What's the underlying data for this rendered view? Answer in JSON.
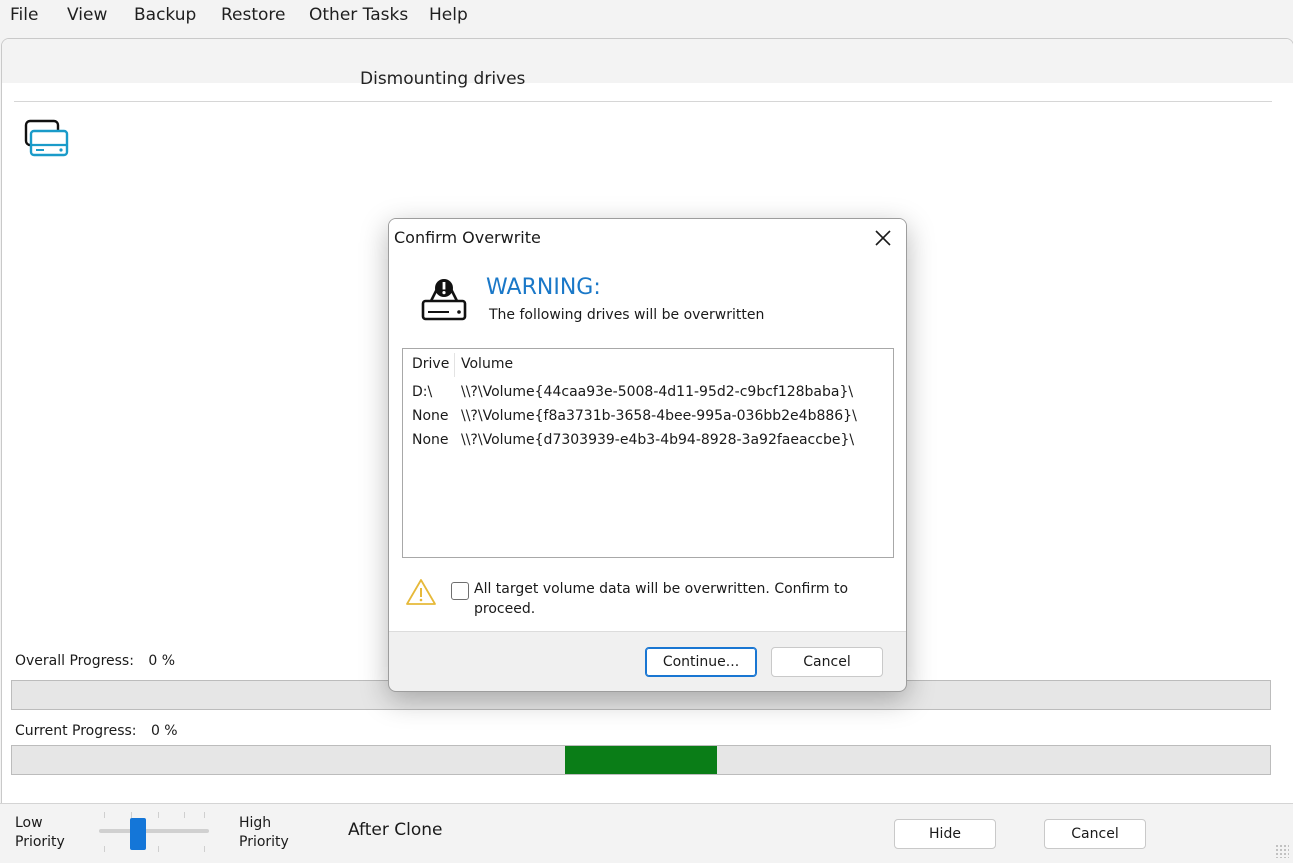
{
  "menu": {
    "items": [
      "File",
      "View",
      "Backup",
      "Restore",
      "Other Tasks",
      "Help"
    ]
  },
  "main": {
    "step_title": "Dismounting drives",
    "icon": "stacked-drives-icon",
    "overall_progress": {
      "label": "Overall Progress:",
      "value_text": "0 %",
      "percent": 0
    },
    "current_progress": {
      "label": "Current Progress:",
      "value_text": "0 %",
      "percent": 0
    },
    "marquee_color": "#0a7d17"
  },
  "bottom": {
    "priority_low": "Low\nPriority",
    "priority_high": "High\nPriority",
    "priority_level": 0.33,
    "after_clone": "After Clone",
    "hide_label": "Hide",
    "cancel_label": "Cancel"
  },
  "dialog": {
    "title": "Confirm Overwrite",
    "warning_title": "WARNING:",
    "warning_subtitle": "The following drives will be overwritten",
    "columns": [
      "Drive",
      "Volume"
    ],
    "rows": [
      {
        "drive": "D:\\",
        "volume": "\\\\?\\Volume{44caa93e-5008-4d11-95d2-c9bcf128baba}\\"
      },
      {
        "drive": "None",
        "volume": "\\\\?\\Volume{f8a3731b-3658-4bee-995a-036bb2e4b886}\\"
      },
      {
        "drive": "None",
        "volume": "\\\\?\\Volume{d7303939-e4b3-4b94-8928-3a92faeaccbe}\\"
      }
    ],
    "confirm_text": "All target volume data will be overwritten. Confirm to proceed.",
    "confirm_checked": false,
    "continue_label": "Continue...",
    "cancel_label": "Cancel",
    "accent_color": "#1a78c8"
  }
}
